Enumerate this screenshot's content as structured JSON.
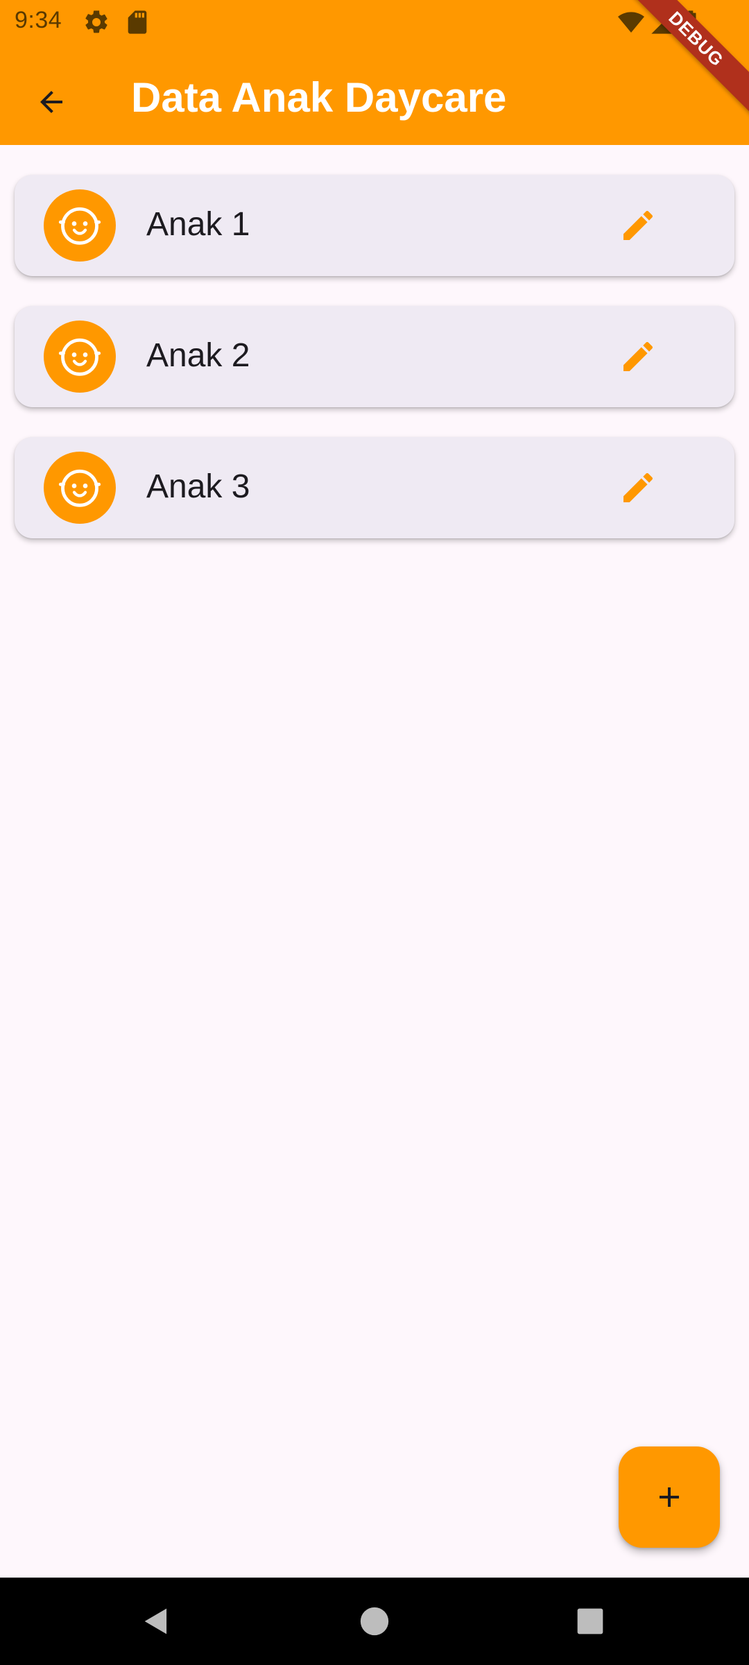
{
  "status_bar": {
    "time": "9:34",
    "icons": [
      "settings-icon",
      "sd-card-icon",
      "wifi-icon",
      "cell-signal-icon",
      "battery-icon"
    ]
  },
  "app_bar": {
    "title": "Data Anak Daycare",
    "back_icon": "arrow-back-icon",
    "debug_label": "DEBUG",
    "background_color": "#ff9800",
    "title_color": "#ffffff"
  },
  "children": [
    {
      "name": "Anak 1",
      "avatar_icon": "child-face-icon",
      "action_icon": "edit-icon"
    },
    {
      "name": "Anak 2",
      "avatar_icon": "child-face-icon",
      "action_icon": "edit-icon"
    },
    {
      "name": "Anak 3",
      "avatar_icon": "child-face-icon",
      "action_icon": "edit-icon"
    }
  ],
  "fab": {
    "icon": "add-icon",
    "color": "#ff9800"
  },
  "colors": {
    "accent": "#ff9800",
    "card_background": "#efeaf3",
    "page_background": "#fef7fc"
  }
}
